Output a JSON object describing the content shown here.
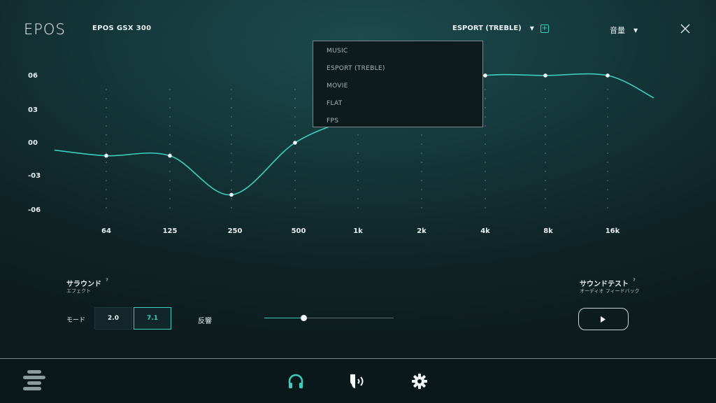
{
  "header": {
    "logo": "EPOS",
    "device_name": "EPOS GSX 300",
    "preset_selected": "ESPORT (TREBLE)",
    "volume_label": "音量"
  },
  "equalizer": {
    "y_ticks": [
      "06",
      "03",
      "00",
      "-03",
      "-06"
    ],
    "x_ticks": [
      "64",
      "125",
      "250",
      "500",
      "1k",
      "2k",
      "4k",
      "8k",
      "16k"
    ],
    "gains_db": [
      -1.2,
      -1.2,
      -4.8,
      0.0,
      2.5,
      5.0,
      6.2,
      6.2,
      6.2
    ],
    "accent_color": "#3bcfc0"
  },
  "preset_dropdown": {
    "items": [
      "MUSIC",
      "ESPORT (TREBLE)",
      "MOVIE",
      "FLAT",
      "FPS"
    ]
  },
  "surround": {
    "title": "サラウンド",
    "subtitle": "エフェクト",
    "mode_label": "モード",
    "mode_options": [
      "2.0",
      "7.1"
    ],
    "mode_selected": "7.1",
    "reverb_label": "反響",
    "reverb_level": 0.3
  },
  "sound_test": {
    "title": "サウンドテスト",
    "subtitle": "オーディオ フィードバック"
  },
  "help_glyph": "?",
  "bottom_nav": {
    "items": [
      "menu-icon",
      "headphones-icon",
      "microphone-icon",
      "gear-icon"
    ],
    "active": "headphones-icon"
  }
}
